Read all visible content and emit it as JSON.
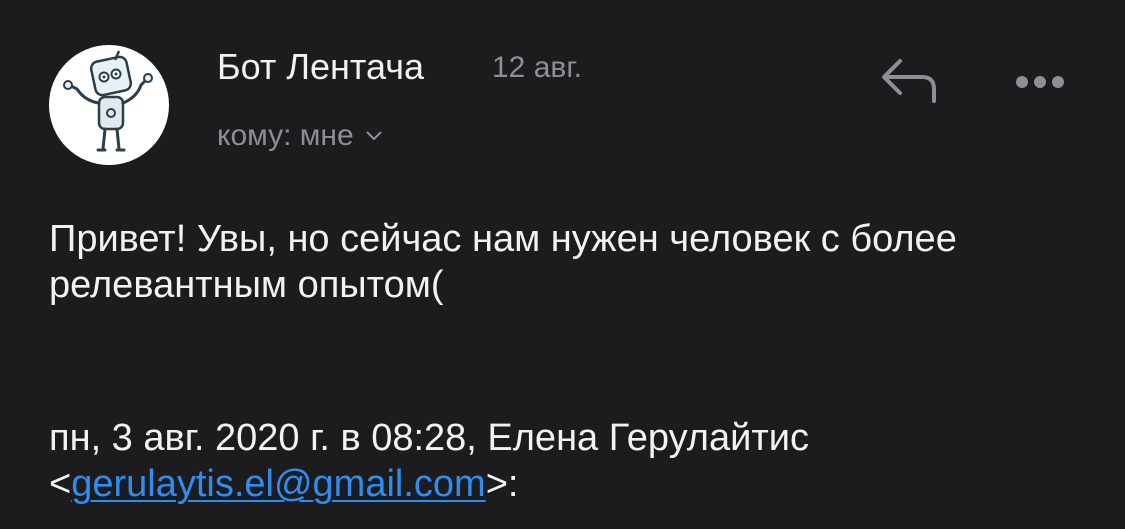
{
  "sender": {
    "name": "Бот Лентача",
    "date": "12 авг."
  },
  "recipient": {
    "label": "кому: мне"
  },
  "message": {
    "body": "Привет! Увы, но сейчас нам нужен человек с более релевантным опытом("
  },
  "quote": {
    "line1": "пн, 3 авг. 2020 г. в 08:28, Елена Герулайтис",
    "open_bracket": "<",
    "email": "gerulaytis.el@gmail.com",
    "close_bracket": ">:"
  },
  "colors": {
    "background": "#1c1c1e",
    "text_primary": "#f2f2f4",
    "text_secondary": "#8e8e93",
    "link": "#2f8cf0"
  },
  "icons": {
    "avatar": "robot-avatar",
    "recipient_toggle": "chevron-down-icon",
    "reply": "reply-icon",
    "more": "more-icon"
  }
}
